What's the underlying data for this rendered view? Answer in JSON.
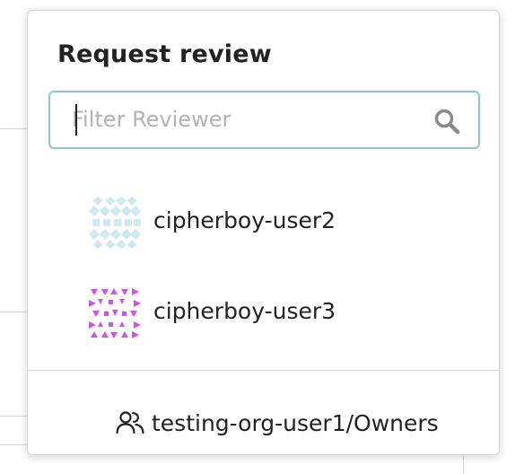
{
  "popover": {
    "title": "Request review",
    "search": {
      "placeholder": "Filter Reviewer",
      "value": ""
    },
    "reviewers": [
      {
        "name": "cipherboy-user2",
        "avatar_color": "#cfe9ee"
      },
      {
        "name": "cipherboy-user3",
        "avatar_color": "#cc55e6"
      }
    ],
    "team": {
      "name": "testing-org-user1/Owners",
      "icon": "people-icon"
    }
  },
  "colors": {
    "focus_border": "#8fc3dc",
    "text": "#222222",
    "placeholder": "#b3b3b3"
  }
}
